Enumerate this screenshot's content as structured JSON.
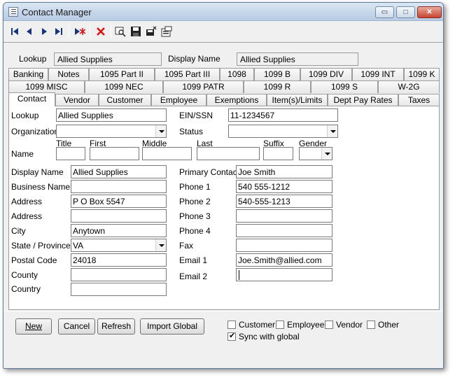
{
  "window": {
    "title": "Contact Manager"
  },
  "titlebar_buttons": {
    "minimize": "▭",
    "maximize": "□",
    "close": "✕"
  },
  "toolbar": [
    {
      "name": "first-record-icon",
      "glyph": "⏮"
    },
    {
      "name": "previous-record-icon",
      "glyph": "◀"
    },
    {
      "name": "next-record-icon",
      "glyph": "▶"
    },
    {
      "name": "last-record-icon",
      "glyph": "⏭"
    },
    {
      "name": "new-record-icon",
      "glyph": "▶✱"
    },
    {
      "name": "delete-record-icon",
      "glyph": "✕"
    },
    {
      "name": "find-icon",
      "glyph": "🔍"
    },
    {
      "name": "save-icon",
      "glyph": "💾"
    },
    {
      "name": "print-preview-icon",
      "glyph": "📄"
    },
    {
      "name": "properties-icon",
      "glyph": "🗂"
    }
  ],
  "header": {
    "lookup_label": "Lookup",
    "lookup_value": "Allied Supplies",
    "display_name_label": "Display Name",
    "display_name_value": "Allied Supplies"
  },
  "tabs": {
    "row1": [
      "Banking",
      "Notes",
      "1095 Part II",
      "1095 Part III",
      "1098",
      "1099 B",
      "1099 DIV",
      "1099 INT",
      "1099 K"
    ],
    "row2": [
      "1099 MISC",
      "1099 NEC",
      "1099 PATR",
      "1099 R",
      "1099 S",
      "W-2G"
    ],
    "row3": [
      "Contact",
      "Vendor",
      "Customer",
      "Employee",
      "Exemptions",
      "Item(s)/Limits",
      "Dept Pay Rates",
      "Taxes"
    ],
    "active": "Contact"
  },
  "contact": {
    "lookup_label": "Lookup",
    "lookup_value": "Allied Supplies",
    "ein_label": "EIN/SSN",
    "ein_value": "11-1234567",
    "organization_label": "Organization",
    "organization_value": "",
    "status_label": "Status",
    "status_value": "",
    "name_label": "Name",
    "name_titles": {
      "title": "Title",
      "first": "First",
      "middle": "Middle",
      "last": "Last",
      "suffix": "Suffix",
      "gender": "Gender"
    },
    "name_values": {
      "title": "",
      "first": "",
      "middle": "",
      "last": "",
      "suffix": "",
      "gender": ""
    },
    "display_name_label": "Display Name",
    "display_name_value": "Allied Supplies",
    "business_name_label": "Business Name",
    "business_name_value": "",
    "address1_label": "Address",
    "address1_value": "P O Box 5547",
    "address2_label": "Address",
    "address2_value": "",
    "city_label": "City",
    "city_value": "Anytown",
    "state_label": "State / Province",
    "state_value": "VA",
    "postal_label": "Postal Code",
    "postal_value": "24018",
    "county_label": "County",
    "county_value": "",
    "country_label": "Country",
    "country_value": "",
    "primary_contact_label": "Primary Contact",
    "primary_contact_value": "Joe Smith",
    "phone1_label": "Phone 1",
    "phone1_value": "540 555-1212",
    "phone2_label": "Phone 2",
    "phone2_value": "540-555-1213",
    "phone3_label": "Phone 3",
    "phone3_value": "",
    "phone4_label": "Phone 4",
    "phone4_value": "",
    "fax_label": "Fax",
    "fax_value": "",
    "email1_label": "Email 1",
    "email1_value": "Joe.Smith@allied.com",
    "email2_label": "Email 2",
    "email2_value": ""
  },
  "footer": {
    "new_label": "New",
    "cancel_label": "Cancel",
    "refresh_label": "Refresh",
    "import_label": "Import Global",
    "customer_label": "Customer",
    "employee_label": "Employee",
    "vendor_label": "Vendor",
    "other_label": "Other",
    "sync_label": "Sync with global",
    "customer_checked": false,
    "employee_checked": false,
    "vendor_checked": false,
    "other_checked": false,
    "sync_checked": true
  }
}
